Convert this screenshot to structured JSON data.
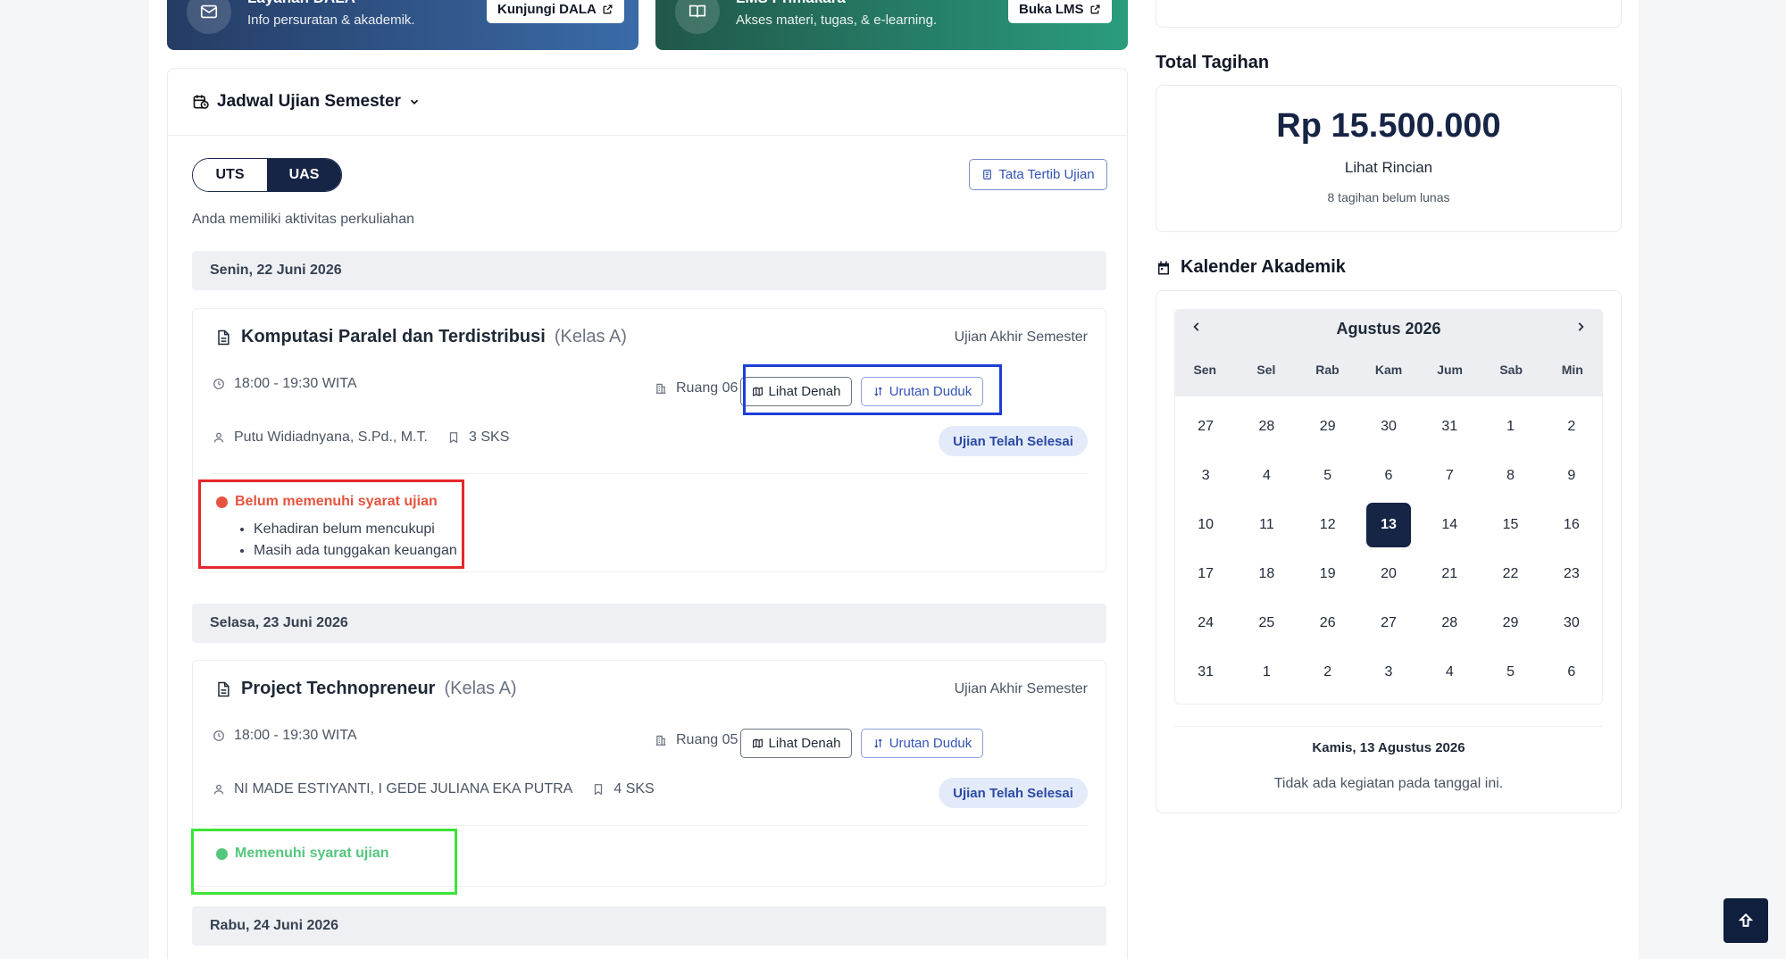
{
  "banners": [
    {
      "title": "Layanan DALA",
      "subtitle": "Info persuratan & akademik.",
      "button": "Kunjungi DALA"
    },
    {
      "title": "LMS Primakara",
      "subtitle": "Akses materi, tugas, & e-learning.",
      "button": "Buka LMS"
    }
  ],
  "schedule": {
    "title": "Jadwal Ujian Semester",
    "tabs": [
      "UTS",
      "UAS"
    ],
    "active_tab": "UAS",
    "rules_button": "Tata Tertib Ujian",
    "info": "Anda memiliki aktivitas perkuliahan",
    "days": [
      {
        "date": "Senin, 22 Juni 2026",
        "exam": {
          "course": "Komputasi Paralel dan Terdistribusi",
          "class": "(Kelas A)",
          "type": "Ujian Akhir Semester",
          "time": "18:00 - 19:30 WITA",
          "room": "Ruang 06",
          "lecturer": "Putu Widiadnyana, S.Pd., M.T.",
          "credits": "3 SKS",
          "map_button": "Lihat Denah",
          "seat_button": "Urutan Duduk",
          "status": "Ujian Telah Selesai",
          "requirement": "Belum memenuhi syarat ujian",
          "requirement_color": "#e5543f",
          "reasons": [
            "Kehadiran belum mencukupi",
            "Masih ada tunggakan keuangan"
          ]
        }
      },
      {
        "date": "Selasa, 23 Juni 2026",
        "exam": {
          "course": "Project Technopreneur",
          "class": "(Kelas A)",
          "type": "Ujian Akhir Semester",
          "time": "18:00 - 19:30 WITA",
          "room": "Ruang 05",
          "lecturer": "NI MADE ESTIYANTI, I GEDE JULIANA EKA PUTRA",
          "credits": "4 SKS",
          "map_button": "Lihat Denah",
          "seat_button": "Urutan Duduk",
          "status": "Ujian Telah Selesai",
          "requirement": "Memenuhi syarat ujian",
          "requirement_color": "#54c77d"
        }
      },
      {
        "date": "Rabu, 24 Juni 2026"
      }
    ]
  },
  "billing": {
    "title": "Total Tagihan",
    "amount": "Rp 15.500.000",
    "link": "Lihat Rincian",
    "note": "8 tagihan belum lunas"
  },
  "calendar": {
    "title": "Kalender Akademik",
    "month": "Agustus 2026",
    "weekdays": [
      "Sen",
      "Sel",
      "Rab",
      "Kam",
      "Jum",
      "Sab",
      "Min"
    ],
    "weeks": [
      [
        "27",
        "28",
        "29",
        "30",
        "31",
        "1",
        "2"
      ],
      [
        "3",
        "4",
        "5",
        "6",
        "7",
        "8",
        "9"
      ],
      [
        "10",
        "11",
        "12",
        "13",
        "14",
        "15",
        "16"
      ],
      [
        "17",
        "18",
        "19",
        "20",
        "21",
        "22",
        "23"
      ],
      [
        "24",
        "25",
        "26",
        "27",
        "28",
        "29",
        "30"
      ],
      [
        "31",
        "1",
        "2",
        "3",
        "4",
        "5",
        "6"
      ]
    ],
    "selected": "13",
    "selected_label": "Kamis, 13 Agustus 2026",
    "empty_message": "Tidak ada kegiatan pada tanggal ini."
  },
  "colors": {
    "primary": "#162445",
    "accent_blue": "#3453b5",
    "error": "#e5543f",
    "success": "#54c77d"
  }
}
